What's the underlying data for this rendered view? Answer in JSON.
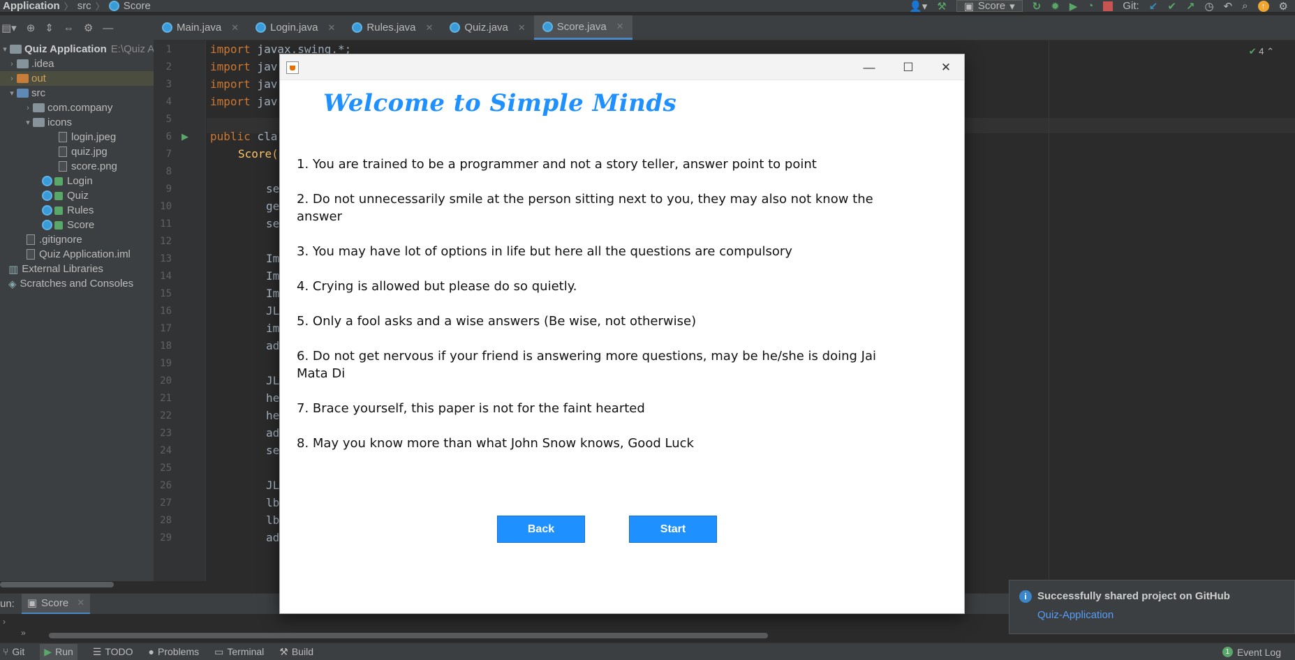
{
  "topbar": {
    "breadcrumb": [
      "Application",
      "src",
      "Score"
    ],
    "run_config": "Score",
    "git_label": "Git:"
  },
  "tabs": [
    "Main.java",
    "Login.java",
    "Rules.java",
    "Quiz.java",
    "Score.java"
  ],
  "project": {
    "root_name": "Quiz Application",
    "root_path": "E:\\Quiz Ap",
    "items": {
      "idea": ".idea",
      "out": "out",
      "src": "src",
      "com_company": "com.company",
      "icons": "icons",
      "login_jpeg": "login.jpeg",
      "quiz_jpg": "quiz.jpg",
      "score_png": "score.png",
      "login": "Login",
      "quiz": "Quiz",
      "rules": "Rules",
      "score": "Score",
      "gitignore": ".gitignore",
      "iml": "Quiz Application.iml",
      "ext_libs": "External Libraries",
      "scratches": "Scratches and Consoles"
    }
  },
  "editor": {
    "line_numbers": [
      "1",
      "2",
      "3",
      "4",
      "5",
      "6",
      "7",
      "8",
      "9",
      "10",
      "11",
      "12",
      "13",
      "14",
      "15",
      "16",
      "17",
      "18",
      "19",
      "20",
      "21",
      "22",
      "23",
      "24",
      "25",
      "26",
      "27",
      "28",
      "29"
    ],
    "l1_kw": "import",
    "l1_rest": " javax.swing.*;",
    "l2_rest": " jav",
    "l3_rest": " jav",
    "l4_rest": " jav",
    "l6_kw": "public",
    "l6_rest": " cla",
    "l7_fn": "Score(",
    "frags": [
      "se",
      "ge",
      "se",
      "Im",
      "Im",
      "Im",
      "JL",
      "im",
      "ad",
      "JL",
      "he",
      "he",
      "ad",
      "se",
      "JL",
      "lb",
      "lb",
      "ad"
    ],
    "inspection_count": "4"
  },
  "run": {
    "label": "un:",
    "tab": "Score"
  },
  "status": {
    "git": "Git",
    "run": "Run",
    "todo": "TODO",
    "problems": "Problems",
    "terminal": "Terminal",
    "build": "Build",
    "event_log": "Event Log",
    "event_count": "1"
  },
  "notification": {
    "title": "Successfully shared project on GitHub",
    "link": "Quiz-Application"
  },
  "dialog": {
    "heading": "Welcome to Simple Minds",
    "rules": [
      "1. You are trained to be a programmer and not a story teller, answer point to point",
      "2. Do not unnecessarily smile at the person sitting next to you, they may also not know the answer",
      "3. You may have lot of options in life but here all the questions are compulsory",
      "4. Crying is allowed but please do so quietly.",
      "5. Only a fool asks and a wise answers (Be wise, not otherwise)",
      "6. Do not get nervous if your friend is answering more questions, may be he/she is doing Jai Mata Di",
      "7. Brace yourself, this paper is not for the faint hearted",
      "8. May you know more than what John Snow knows, Good Luck"
    ],
    "back_label": "Back",
    "start_label": "Start"
  },
  "colors": {
    "accent_blue": "#1e90ff",
    "ide_bg": "#2b2b2b",
    "panel_bg": "#3c3f41"
  }
}
